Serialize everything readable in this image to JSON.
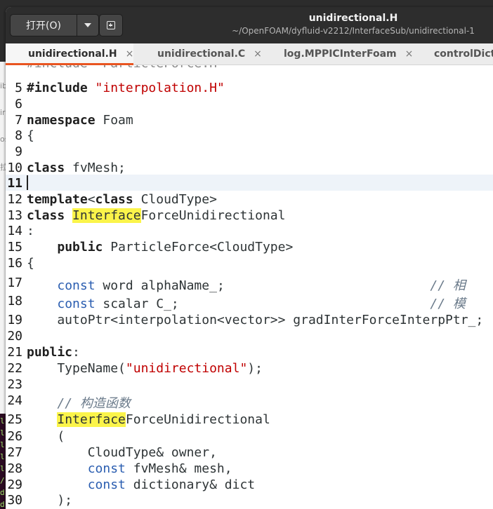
{
  "window": {
    "title": "unidirectional.H",
    "path": "~/OpenFOAM/dyfluid-v2212/InterfaceSub/unidirectional-1",
    "open_label": "打开(O)"
  },
  "desktop": {
    "strip_glyphs": [
      "ibl",
      "ire",
      "os",
      "拉"
    ],
    "terminal_glyphs": [
      "l",
      "l",
      "l",
      "l",
      "l",
      "/",
      "d",
      "d"
    ]
  },
  "tabs": [
    {
      "label": "unidirectional.H",
      "active": true,
      "close": "×"
    },
    {
      "label": "unidirectional.C",
      "active": false,
      "close": "×"
    },
    {
      "label": "log.MPPICInterFoam",
      "active": false,
      "close": "×"
    },
    {
      "label": "controlDict",
      "active": false,
      "close": ""
    }
  ],
  "editor": {
    "partial_top_line": "#include \"ParticleForce.H\"",
    "current_line": 11,
    "lines": [
      {
        "n": "5",
        "segs": [
          {
            "t": "#include ",
            "c": "kw"
          },
          {
            "t": "\"interpolation.H\"",
            "c": "str"
          }
        ]
      },
      {
        "n": "6",
        "segs": []
      },
      {
        "n": "7",
        "segs": [
          {
            "t": "namespace",
            "c": "kw"
          },
          {
            "t": " Foam",
            "c": ""
          }
        ]
      },
      {
        "n": "8",
        "segs": [
          {
            "t": "{",
            "c": ""
          }
        ]
      },
      {
        "n": "9",
        "segs": []
      },
      {
        "n": "10",
        "segs": [
          {
            "t": "class",
            "c": "kw"
          },
          {
            "t": " fvMesh;",
            "c": ""
          }
        ]
      },
      {
        "n": "11",
        "segs": []
      },
      {
        "n": "12",
        "segs": [
          {
            "t": "template",
            "c": "kw"
          },
          {
            "t": "<",
            "c": ""
          },
          {
            "t": "class",
            "c": "kw"
          },
          {
            "t": " CloudType>",
            "c": ""
          }
        ]
      },
      {
        "n": "13",
        "segs": [
          {
            "t": "class",
            "c": "kw"
          },
          {
            "t": " ",
            "c": ""
          },
          {
            "t": "Interface",
            "c": "hl"
          },
          {
            "t": "ForceUnidirectional",
            "c": ""
          }
        ]
      },
      {
        "n": "14",
        "segs": [
          {
            "t": ":",
            "c": ""
          }
        ]
      },
      {
        "n": "15",
        "segs": [
          {
            "t": "    ",
            "c": ""
          },
          {
            "t": "public",
            "c": "kw"
          },
          {
            "t": " ParticleForce<CloudType>",
            "c": ""
          }
        ]
      },
      {
        "n": "16",
        "segs": [
          {
            "t": "{",
            "c": ""
          }
        ]
      },
      {
        "n": "17",
        "segs": [
          {
            "t": "    ",
            "c": ""
          },
          {
            "t": "const",
            "c": "ty"
          },
          {
            "t": " word alphaName_;",
            "c": ""
          },
          {
            "t": "                           // 相",
            "c": "cm"
          }
        ]
      },
      {
        "n": "18",
        "segs": [
          {
            "t": "    ",
            "c": ""
          },
          {
            "t": "const",
            "c": "ty"
          },
          {
            "t": " scalar C_;",
            "c": ""
          },
          {
            "t": "                                 // 模",
            "c": "cm"
          }
        ]
      },
      {
        "n": "19",
        "segs": [
          {
            "t": "    autoPtr<interpolation<vector>> gradInterForceInterpPtr_;",
            "c": ""
          }
        ]
      },
      {
        "n": "20",
        "segs": []
      },
      {
        "n": "21",
        "segs": [
          {
            "t": "public",
            "c": "kw"
          },
          {
            "t": ":",
            "c": ""
          }
        ]
      },
      {
        "n": "22",
        "segs": [
          {
            "t": "    TypeName(",
            "c": ""
          },
          {
            "t": "\"unidirectional\"",
            "c": "str"
          },
          {
            "t": ");",
            "c": ""
          }
        ]
      },
      {
        "n": "23",
        "segs": []
      },
      {
        "n": "24",
        "segs": [
          {
            "t": "    ",
            "c": ""
          },
          {
            "t": "// 构造函数",
            "c": "cm"
          }
        ]
      },
      {
        "n": "25",
        "segs": [
          {
            "t": "    ",
            "c": ""
          },
          {
            "t": "Interface",
            "c": "hl"
          },
          {
            "t": "ForceUnidirectional",
            "c": ""
          }
        ]
      },
      {
        "n": "26",
        "segs": [
          {
            "t": "    (",
            "c": ""
          }
        ]
      },
      {
        "n": "27",
        "segs": [
          {
            "t": "        CloudType& owner,",
            "c": ""
          }
        ]
      },
      {
        "n": "28",
        "segs": [
          {
            "t": "        ",
            "c": ""
          },
          {
            "t": "const",
            "c": "ty"
          },
          {
            "t": " fvMesh& mesh,",
            "c": ""
          }
        ]
      },
      {
        "n": "29",
        "segs": [
          {
            "t": "        ",
            "c": ""
          },
          {
            "t": "const",
            "c": "ty"
          },
          {
            "t": " dictionary& dict",
            "c": ""
          }
        ]
      },
      {
        "n": "30",
        "segs": [
          {
            "t": "    );",
            "c": ""
          }
        ]
      }
    ]
  }
}
